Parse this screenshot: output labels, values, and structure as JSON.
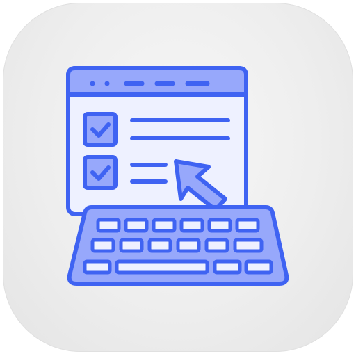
{
  "icon": {
    "name": "online-form-keyboard-icon",
    "colors": {
      "stroke": "#3F63F2",
      "fill_light": "#EEF1FF",
      "fill_mid": "#97A8FB",
      "tile_background": "#EEEEEE"
    },
    "checklist": [
      {
        "checked": true
      },
      {
        "checked": true
      }
    ]
  }
}
